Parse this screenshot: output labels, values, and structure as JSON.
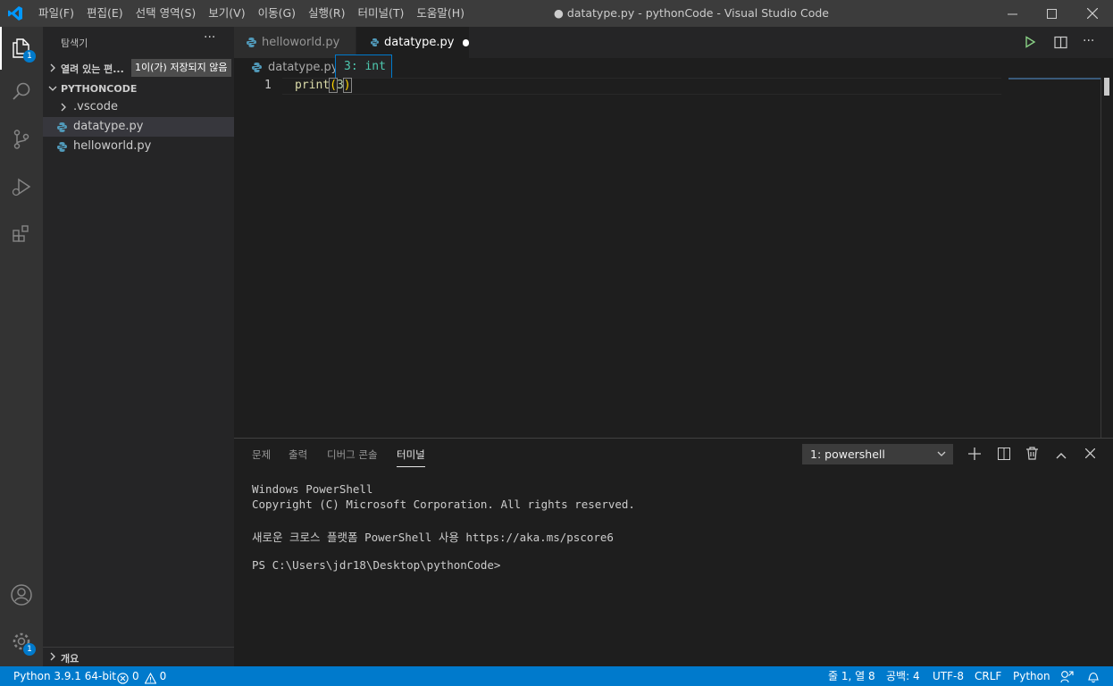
{
  "titlebar": {
    "menu": [
      "파일(F)",
      "편집(E)",
      "선택 영역(S)",
      "보기(V)",
      "이동(G)",
      "실행(R)",
      "터미널(T)",
      "도움말(H)"
    ],
    "window_title": "● datatype.py - pythonCode - Visual Studio Code"
  },
  "activity": {
    "explorer_badge": "1",
    "manage_badge": "1"
  },
  "sidebar": {
    "title": "탐색기",
    "more": "···",
    "open_editors_label": "열려 있는 편...",
    "unsaved_badge": "1이(가) 저장되지 않음",
    "folder_name": "PYTHONCODE",
    "items": [
      {
        "label": ".vscode"
      },
      {
        "label": "datatype.py"
      },
      {
        "label": "helloworld.py"
      }
    ],
    "outline_label": "개요"
  },
  "editor": {
    "tabs": [
      {
        "label": "helloworld.py"
      },
      {
        "label": "datatype.py"
      }
    ],
    "breadcrumb": "datatype.py",
    "hover": "3: int",
    "line_number": "1",
    "code": {
      "func": "print",
      "open": "(",
      "arg": "3",
      "close": ")"
    }
  },
  "panel": {
    "tabs": [
      "문제",
      "출력",
      "디버그 콘솔",
      "터미널"
    ],
    "terminal_select": "1: powershell",
    "terminal_lines": [
      "Windows PowerShell",
      "Copyright (C) Microsoft Corporation. All rights reserved.",
      "새로운 크로스 플랫폼 PowerShell 사용 https://aka.ms/pscore6",
      "PS C:\\Users\\jdr18\\Desktop\\pythonCode>"
    ]
  },
  "statusbar": {
    "interpreter": "Python 3.9.1 64-bit",
    "errors": "0",
    "warnings": "0",
    "position": "줄 1, 열 8",
    "spaces": "공백: 4",
    "encoding": "UTF-8",
    "eol": "CRLF",
    "language": "Python"
  },
  "colors": {
    "accent": "#007acc",
    "python_icon": "#519aba",
    "titlebar": "#3c3c3c"
  }
}
